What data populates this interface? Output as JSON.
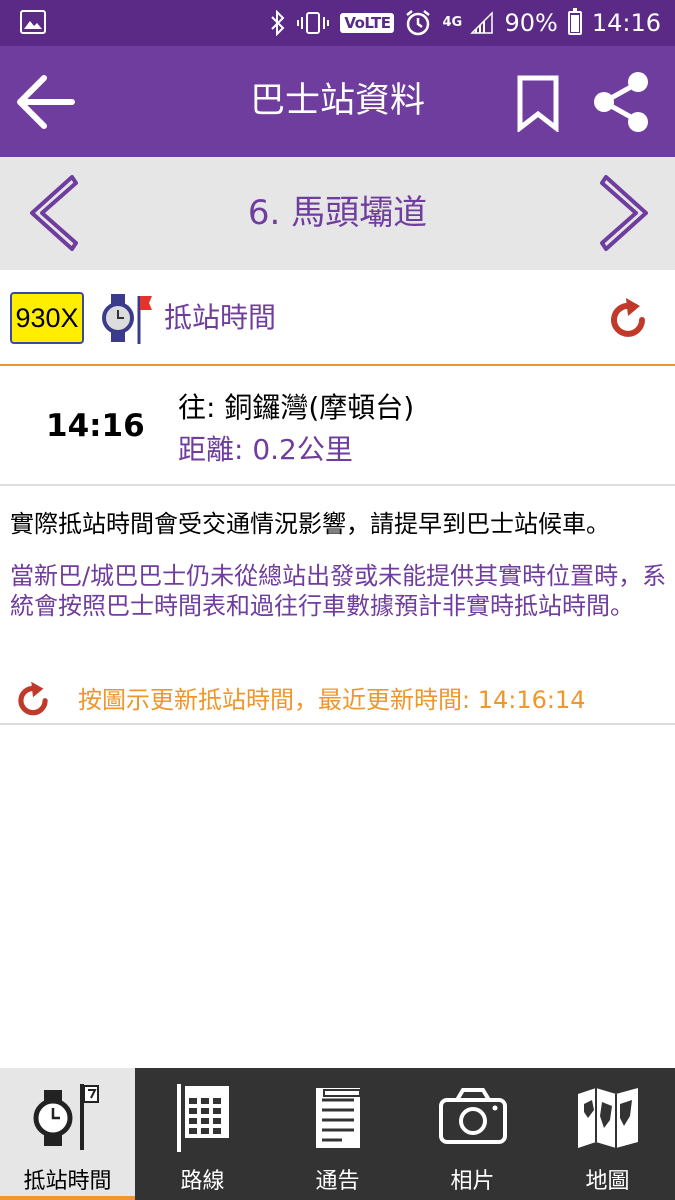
{
  "status_bar": {
    "volte": "VoLTE",
    "network": "4G",
    "battery": "90%",
    "time": "14:16"
  },
  "app_bar": {
    "title": "巴士站資料"
  },
  "stop": {
    "name": "6. 馬頭壩道"
  },
  "route": {
    "number": "930X",
    "section_label": "抵站時間"
  },
  "eta": {
    "time": "14:16",
    "destination": "往: 銅鑼灣(摩頓台)",
    "distance": "距離: 0.2公里"
  },
  "notes": {
    "traffic": "實際抵站時間會受交通情況影響，請提早到巴士站候車。",
    "schedule": "當新巴/城巴巴士仍未從總站出發或未能提供其實時位置時，系統會按照巴士時間表和過往行車數據預計非實時抵站時間。",
    "update": "按圖示更新抵站時間，最近更新時間: 14:16:14"
  },
  "nav": {
    "eta": "抵站時間",
    "route": "路線",
    "notice": "通告",
    "photo": "相片",
    "map": "地圖"
  },
  "colors": {
    "primary": "#6f3d9e",
    "status_bar": "#5a2a86",
    "accent": "#f0962b",
    "refresh": "#c0392b",
    "route_badge": "#ffee00"
  }
}
